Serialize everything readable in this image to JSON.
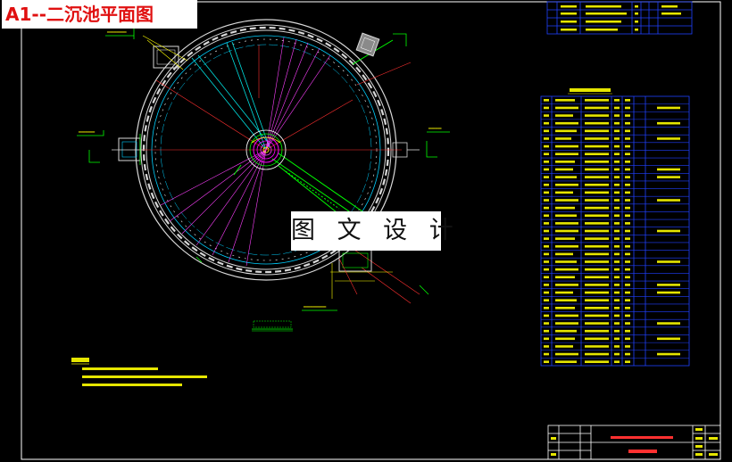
{
  "title": "A1--二沉池平面图",
  "watermark": "图 文 设 计",
  "colors": {
    "background": "#000000",
    "frame": "#ffffff",
    "title": "#e01010",
    "table_lines": "#2040ff",
    "table_text": "#e6e600",
    "tank_walls": "#d8d8d8",
    "inner_rings": "#00d0ff",
    "radial_lines": "#ff40ff",
    "dim_lines": "#ff3030",
    "green_callouts": "#00ff00",
    "center_well": "#ff00ff"
  },
  "icons": [
    "settling-tank-plan",
    "drawing-title-block"
  ]
}
